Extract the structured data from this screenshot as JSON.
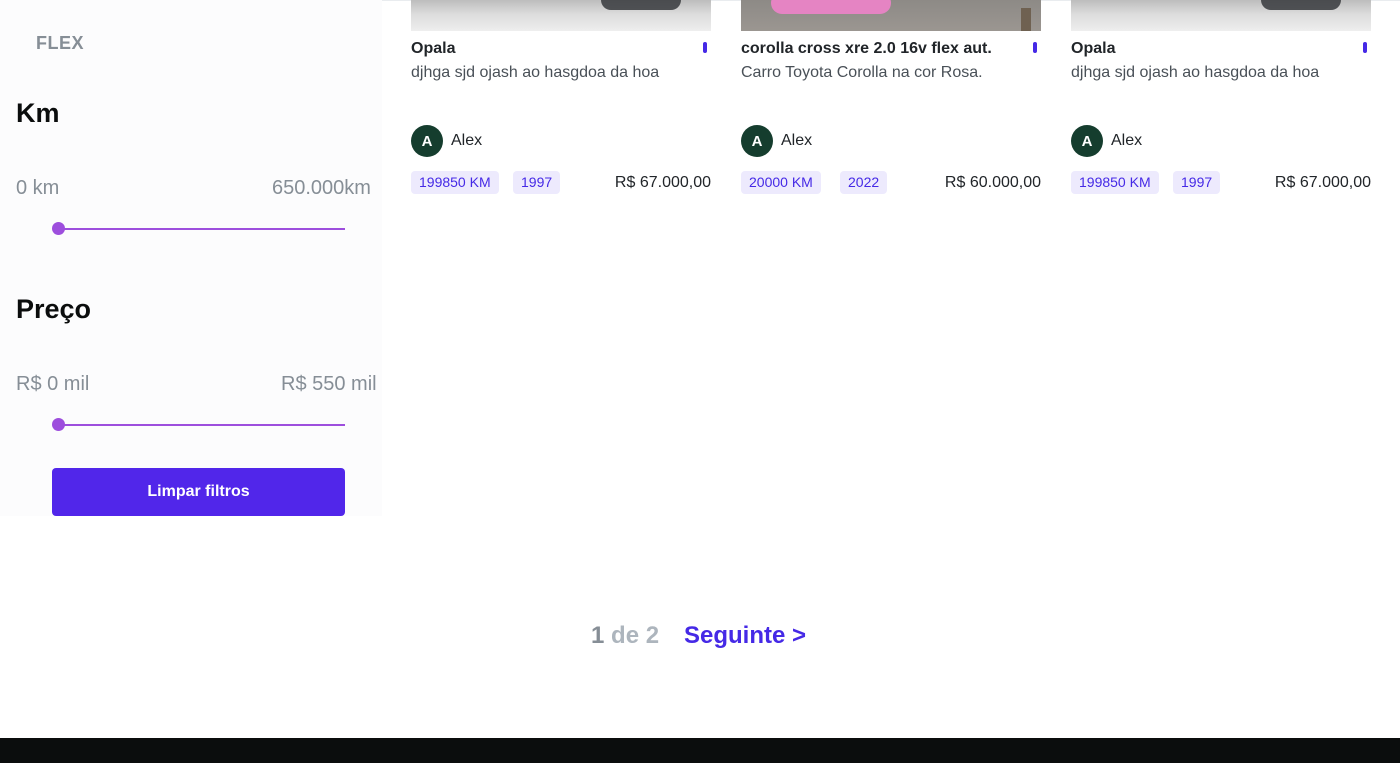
{
  "sidebar": {
    "fuel_option": "FLEX",
    "km": {
      "title": "Km",
      "min_label": "0 km",
      "max_label": "650.000km",
      "slider_value": 0
    },
    "price": {
      "title": "Preço",
      "min_label": "R$ 0 mil",
      "max_label": "R$ 550 mil",
      "slider_value": 0
    },
    "clear_button": "Limpar filtros"
  },
  "cards": [
    {
      "title": "Opala",
      "description": "djhga sjd ojash ao hasgdoa da hoa",
      "owner_initial": "A",
      "owner_name": "Alex",
      "km": "199850 KM",
      "year": "1997",
      "price": "R$ 67.000,00"
    },
    {
      "title": "corolla cross xre 2.0 16v flex aut.",
      "description": "Carro Toyota Corolla na cor Rosa.",
      "owner_initial": "A",
      "owner_name": "Alex",
      "km": "20000 KM",
      "year": "2022",
      "price": "R$ 60.000,00"
    },
    {
      "title": "Opala",
      "description": "djhga sjd ojash ao hasgdoa da hoa",
      "owner_initial": "A",
      "owner_name": "Alex",
      "km": "199850 KM",
      "year": "1997",
      "price": "R$ 67.000,00"
    }
  ],
  "pagination": {
    "current": "1",
    "separator": "de",
    "total": "2",
    "next_label": "Seguinte >"
  },
  "colors": {
    "accent": "#5126ea",
    "slider": "#9d4edd",
    "tag_bg": "#edeafd",
    "avatar": "#153d2e",
    "footer": "#0b0d0d"
  }
}
